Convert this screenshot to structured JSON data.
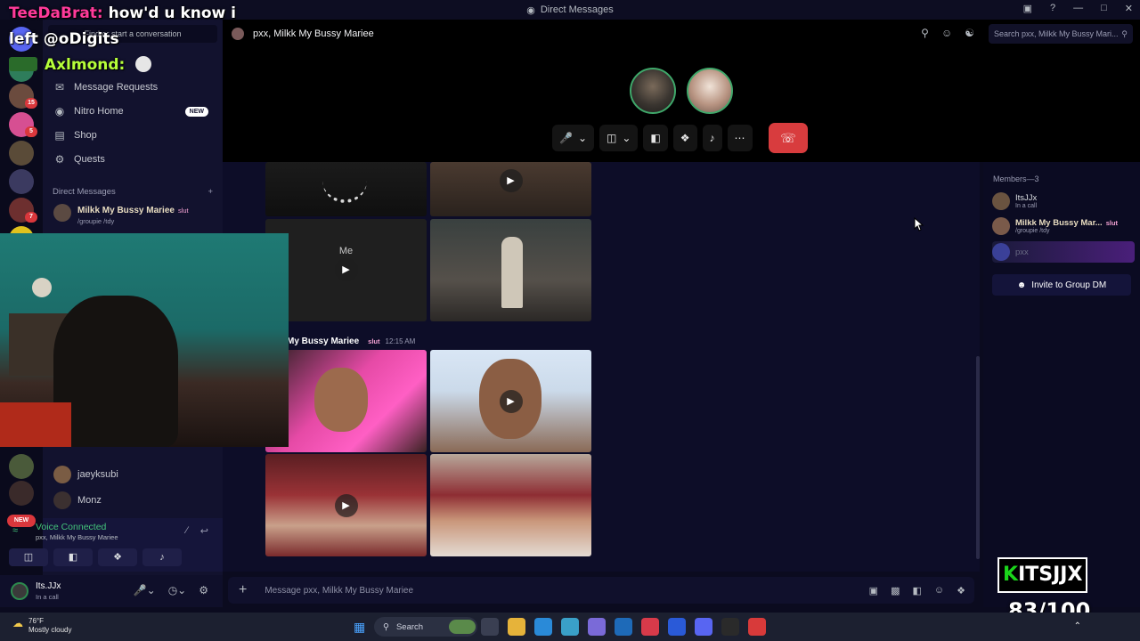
{
  "window": {
    "title": "Direct Messages"
  },
  "overlay": {
    "line1_name": "TeeDaBrat:",
    "line1_text": "how'd u know i",
    "line2": "left @oDigits",
    "line3_name": "Axlmond:",
    "score_name": "ITSJJX",
    "score_value": "83/100"
  },
  "sidebar": {
    "search_placeholder": "Find or start a conversation",
    "nav": [
      {
        "label": "Message Requests",
        "icon": "envelope-icon"
      },
      {
        "label": "Nitro Home",
        "icon": "nitro-icon",
        "badge": "NEW"
      },
      {
        "label": "Shop",
        "icon": "shop-icon"
      },
      {
        "label": "Quests",
        "icon": "quests-icon"
      }
    ],
    "dm_header": "Direct Messages",
    "dms": [
      {
        "name": "Milkk My Bussy Mariee",
        "tag": "slut",
        "status": "/groupie /tdy"
      },
      {
        "name": "jaeyksubi"
      },
      {
        "name": "Monz"
      }
    ],
    "rail_badges": [
      "15",
      "5",
      "7"
    ],
    "rail_new": "NEW"
  },
  "voice": {
    "status": "Voice Connected",
    "channel": "pxx, Milkk My Bussy Mariee"
  },
  "user": {
    "name": "Its.JJx",
    "status": "In a call"
  },
  "header": {
    "channel_name": "pxx, Milkk My Bussy Mariee",
    "search_placeholder": "Search pxx, Milkk My Bussy Mari..."
  },
  "chat": {
    "me_label": "Me",
    "author": "My Bussy Mariee",
    "author_tag": "slut",
    "time": "12:15 AM",
    "composer_placeholder": "Message pxx, Milkk My Bussy Mariee"
  },
  "members": {
    "header": "Members—3",
    "list": [
      {
        "name": "ItsJJx",
        "status": "In a call"
      },
      {
        "name": "Milkk My Bussy Mar...",
        "tag": "slut",
        "status": "/groupie /tdy"
      },
      {
        "name": "pxx"
      }
    ],
    "invite": "Invite to Group DM"
  },
  "taskbar": {
    "weather_temp": "76°F",
    "weather_desc": "Mostly cloudy",
    "search": "Search"
  },
  "colors": {
    "end_call": "#d83c3e",
    "voice_connected": "#43c47a",
    "accent": "#5865f2"
  }
}
